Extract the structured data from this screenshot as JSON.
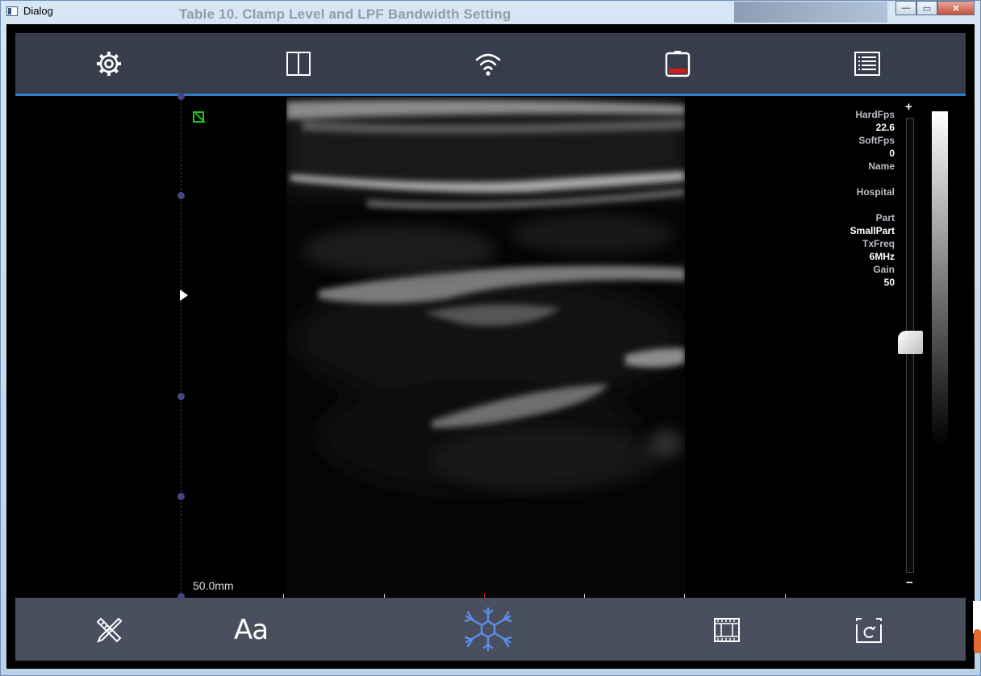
{
  "window": {
    "title": "Dialog",
    "background_doc_text": "Table 10. Clamp Level and LPF Bandwidth Setting",
    "minimize": "—",
    "maximize": "▭",
    "close": "✕"
  },
  "toolbar_top": {
    "items": [
      {
        "name": "settings",
        "icon": "gear-icon"
      },
      {
        "name": "layout",
        "icon": "split-view-icon"
      },
      {
        "name": "wifi",
        "icon": "wifi-icon"
      },
      {
        "name": "battery",
        "icon": "battery-icon"
      },
      {
        "name": "report",
        "icon": "list-document-icon"
      }
    ]
  },
  "toolbar_bottom": {
    "items": [
      {
        "name": "measure",
        "icon": "measure-tools-icon"
      },
      {
        "name": "annotation",
        "label": "Aa",
        "icon": "text-annotation-icon"
      },
      {
        "name": "freeze",
        "icon": "snowflake-icon"
      },
      {
        "name": "cine",
        "icon": "film-icon"
      },
      {
        "name": "capture",
        "icon": "capture-icon"
      }
    ]
  },
  "image": {
    "depth_label": "50.0mm"
  },
  "info_panel": [
    {
      "label": "HardFps",
      "value": "22.6"
    },
    {
      "label": "SoftFps",
      "value": "0"
    },
    {
      "label": "Name",
      "value": ""
    },
    {
      "label": "Hospital",
      "value": ""
    },
    {
      "label": "Part",
      "value": "SmallPart"
    },
    {
      "label": "TxFreq",
      "value": "6MHz"
    },
    {
      "label": "Gain",
      "value": "50"
    }
  ],
  "gain": {
    "plus": "+",
    "minus": "−",
    "level_fraction": 0.5
  },
  "colors": {
    "toolbar_top": "#383d4b",
    "toolbar_bottom": "#4a4f5f",
    "accent_line": "#2f7fc6",
    "freeze_icon": "#5b8fe8",
    "battery_fill": "#d21c1c",
    "roi_box": "#1ec81e"
  }
}
